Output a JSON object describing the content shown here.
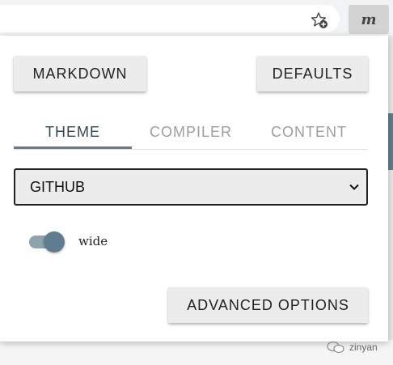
{
  "browser": {
    "bookmark_icon": "star-add-icon",
    "extension_label": "m"
  },
  "popup": {
    "markdown_button": "MARKDOWN",
    "defaults_button": "DEFAULTS",
    "tabs": [
      {
        "label": "THEME",
        "active": true
      },
      {
        "label": "COMPILER",
        "active": false
      },
      {
        "label": "CONTENT",
        "active": false
      }
    ],
    "theme_select": {
      "selected": "GITHUB",
      "icon": "chevron-down-icon"
    },
    "wide_toggle": {
      "label": "wide",
      "on": true
    },
    "advanced_button": "ADVANCED OPTIONS"
  },
  "watermark": {
    "text": "zinyan"
  },
  "colors": {
    "accent": "#607d8b",
    "button_bg": "#ececec",
    "inactive_tab": "#9e9e9e"
  }
}
